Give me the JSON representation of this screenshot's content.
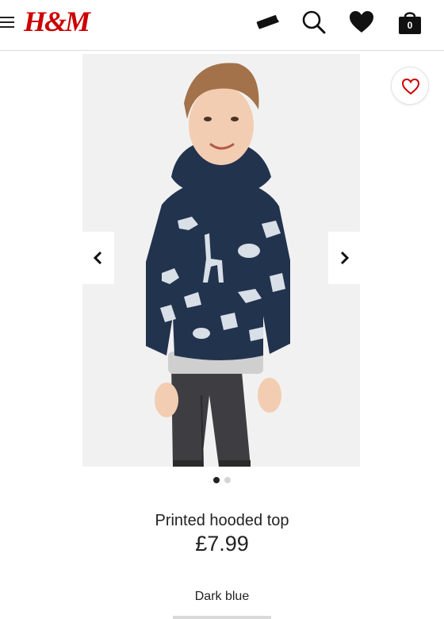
{
  "header": {
    "logo_text": "H&M",
    "menu_icon": "hamburger-icon",
    "icons": [
      "card-icon",
      "search-icon",
      "heart-icon",
      "shopping-bag-icon"
    ],
    "bag_count": "0",
    "brand_color": "#cc0000"
  },
  "product": {
    "name": "Printed hooded top",
    "price": "£7.99",
    "color": "Dark blue",
    "image_description_icon": "product-photo",
    "gallery": {
      "total": 2,
      "active": 1
    }
  },
  "colors": {
    "hoodie": "#22334e",
    "text": "#222222",
    "wishlist_heart": "#cc0000"
  }
}
